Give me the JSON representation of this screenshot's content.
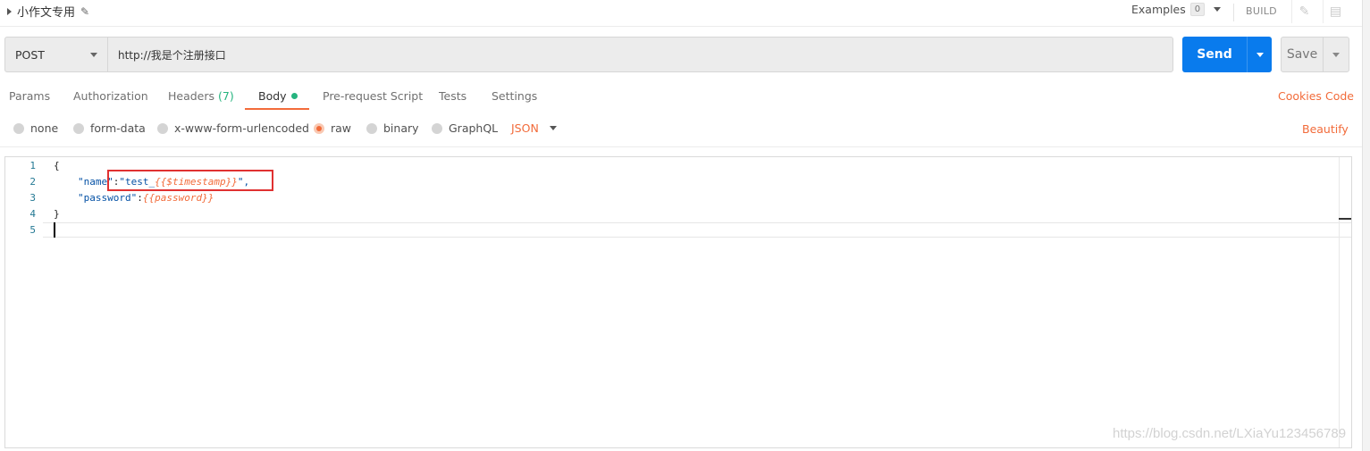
{
  "header": {
    "request_name": "小作文专用",
    "examples_label": "Examples",
    "examples_count": "0",
    "build_label": "BUILD"
  },
  "request": {
    "method": "POST",
    "url": "http://我是个注册接口",
    "send_label": "Send",
    "save_label": "Save"
  },
  "tabs": [
    {
      "label": "Params"
    },
    {
      "label": "Authorization"
    },
    {
      "label": "Headers",
      "count": "(7)"
    },
    {
      "label": "Body",
      "active": true
    },
    {
      "label": "Pre-request Script"
    },
    {
      "label": "Tests"
    },
    {
      "label": "Settings"
    }
  ],
  "right_links": {
    "cookies": "Cookies",
    "code": "Code",
    "beautify": "Beautify"
  },
  "body_types": [
    {
      "label": "none",
      "selected": false
    },
    {
      "label": "form-data",
      "selected": false
    },
    {
      "label": "x-www-form-urlencoded",
      "selected": false
    },
    {
      "label": "raw",
      "selected": true
    },
    {
      "label": "binary",
      "selected": false
    },
    {
      "label": "GraphQL",
      "selected": false
    }
  ],
  "raw_format": "JSON",
  "editor": {
    "line_numbers": [
      "1",
      "2",
      "3",
      "4",
      "5"
    ],
    "lines": {
      "l1": "{",
      "l2_key": "\"name\"",
      "l2_colon": ":",
      "l2_str_start": "\"test_",
      "l2_var": "{{$timestamp}}",
      "l2_str_end": "\",",
      "l3_key": "\"password\"",
      "l3_colon": ":",
      "l3_var": "{{password}}",
      "l4": "}"
    }
  },
  "watermark": "https://blog.csdn.net/LXiaYu123456789",
  "colors": {
    "accent": "#f26b3a",
    "send": "#097bed",
    "status_green": "#26b47f",
    "highlight_box": "#e03131"
  }
}
